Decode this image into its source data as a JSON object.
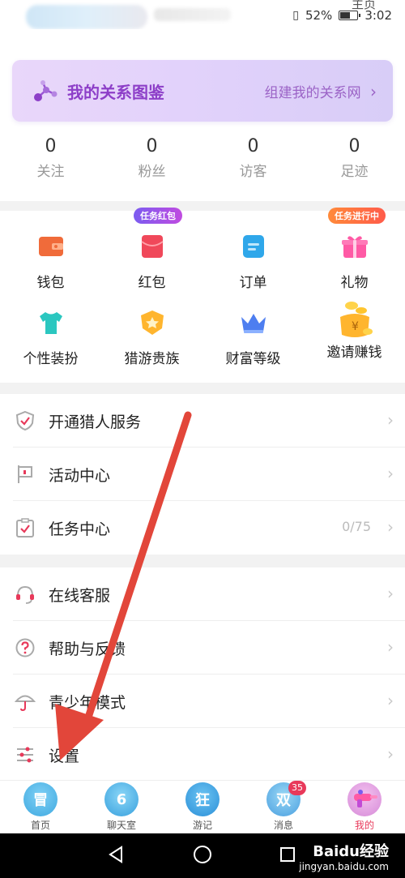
{
  "status_bar": {
    "signal": "52%",
    "time": "3:02",
    "homepage": "主页",
    "left_digits": "113"
  },
  "relation_banner": {
    "title": "我的关系图鉴",
    "link": "组建我的关系网",
    "chevron": "›"
  },
  "stats": [
    {
      "value": "0",
      "label": "关注"
    },
    {
      "value": "0",
      "label": "粉丝"
    },
    {
      "value": "0",
      "label": "访客"
    },
    {
      "value": "0",
      "label": "足迹"
    }
  ],
  "grid": [
    {
      "label": "钱包",
      "icon": "wallet-icon"
    },
    {
      "label": "红包",
      "icon": "red-envelope-icon",
      "badge": "任务红包"
    },
    {
      "label": "订单",
      "icon": "order-icon"
    },
    {
      "label": "礼物",
      "icon": "gift-icon",
      "badge": "任务进行中"
    },
    {
      "label": "个性装扮",
      "icon": "tshirt-icon"
    },
    {
      "label": "猎游贵族",
      "icon": "noble-badge-icon"
    },
    {
      "label": "财富等级",
      "icon": "crown-icon"
    },
    {
      "label": "邀请赚钱",
      "icon": "coins-icon"
    }
  ],
  "menu_group1": [
    {
      "label": "开通猎人服务",
      "icon": "shield-check-icon"
    },
    {
      "label": "活动中心",
      "icon": "flag-icon"
    },
    {
      "label": "任务中心",
      "icon": "clipboard-check-icon",
      "value": "0/75"
    }
  ],
  "menu_group2": [
    {
      "label": "在线客服",
      "icon": "headset-icon"
    },
    {
      "label": "帮助与反馈",
      "icon": "question-icon"
    },
    {
      "label": "青少年模式",
      "icon": "umbrella-icon"
    },
    {
      "label": "设置",
      "icon": "sliders-icon"
    }
  ],
  "tabs": [
    {
      "label": "首页",
      "icon_text": "冒",
      "color": "#3fa9e0"
    },
    {
      "label": "聊天室",
      "icon_text": "6",
      "color": "#38a0dd"
    },
    {
      "label": "游记",
      "icon_text": "狂",
      "color": "#2b8fd8"
    },
    {
      "label": "消息",
      "icon_text": "双",
      "color": "#4a9fe0",
      "badge": "35"
    },
    {
      "label": "我的",
      "icon_text": "",
      "color": "#d68ad8"
    }
  ],
  "watermark": {
    "brand": "Baidu经验",
    "url": "jingyan.baidu.com"
  },
  "colors": {
    "accent": "#e8395a",
    "purple": "#8d3fc8",
    "arrow": "#e2463a"
  }
}
